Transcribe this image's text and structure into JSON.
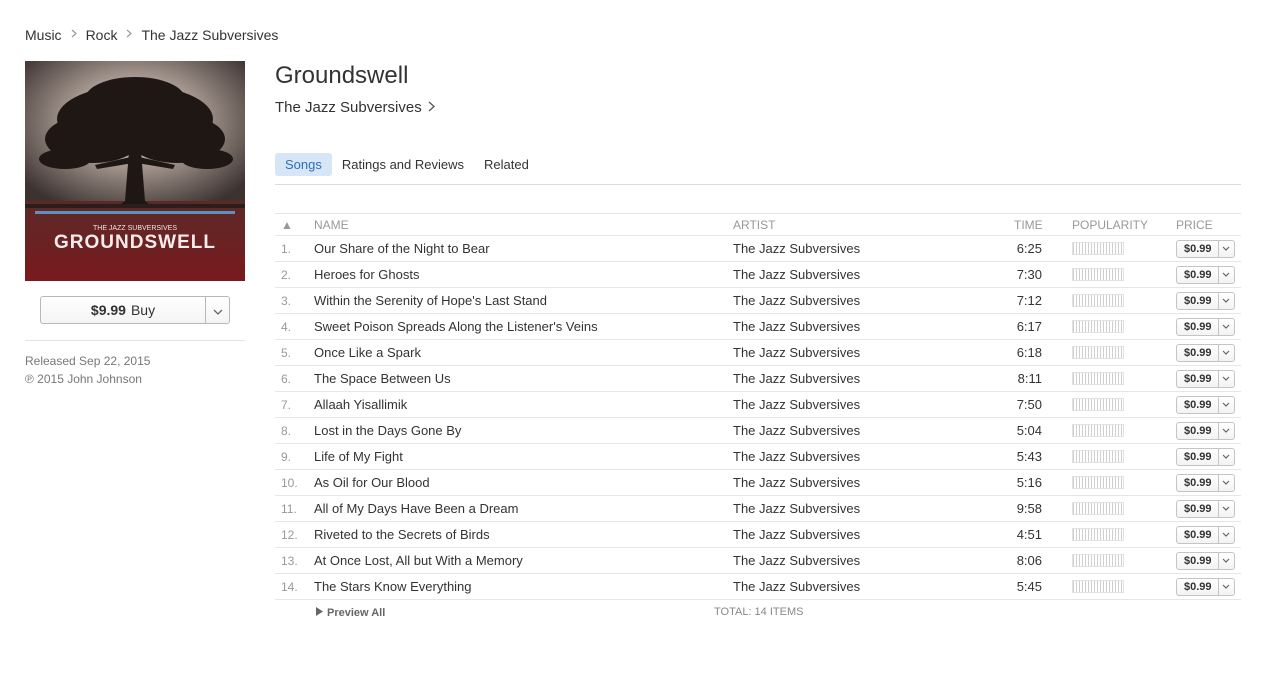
{
  "breadcrumb": [
    "Music",
    "Rock",
    "The Jazz Subversives"
  ],
  "album": {
    "title": "Groundswell",
    "artist": "The Jazz Subversives",
    "cover_band_text": "THE JAZZ SUBVERSIVES",
    "cover_title_text": "GROUNDSWELL",
    "price": "$9.99",
    "buy_label": "Buy",
    "released": "Released Sep 22, 2015",
    "copyright": "℗ 2015 John Johnson"
  },
  "tabs": [
    {
      "label": "Songs",
      "active": true
    },
    {
      "label": "Ratings and Reviews",
      "active": false
    },
    {
      "label": "Related",
      "active": false
    }
  ],
  "columns": {
    "sort_indicator": "▲",
    "name": "NAME",
    "artist": "ARTIST",
    "time": "TIME",
    "popularity": "POPULARITY",
    "price": "PRICE"
  },
  "tracks": [
    {
      "num": "1.",
      "name": "Our Share of the Night to Bear",
      "artist": "The Jazz Subversives",
      "time": "6:25",
      "price": "$0.99"
    },
    {
      "num": "2.",
      "name": "Heroes for Ghosts",
      "artist": "The Jazz Subversives",
      "time": "7:30",
      "price": "$0.99"
    },
    {
      "num": "3.",
      "name": "Within the Serenity of Hope's Last Stand",
      "artist": "The Jazz Subversives",
      "time": "7:12",
      "price": "$0.99"
    },
    {
      "num": "4.",
      "name": "Sweet Poison Spreads Along the Listener's Veins",
      "artist": "The Jazz Subversives",
      "time": "6:17",
      "price": "$0.99"
    },
    {
      "num": "5.",
      "name": "Once Like a Spark",
      "artist": "The Jazz Subversives",
      "time": "6:18",
      "price": "$0.99"
    },
    {
      "num": "6.",
      "name": "The Space Between Us",
      "artist": "The Jazz Subversives",
      "time": "8:11",
      "price": "$0.99"
    },
    {
      "num": "7.",
      "name": "Allaah Yisallimik",
      "artist": "The Jazz Subversives",
      "time": "7:50",
      "price": "$0.99"
    },
    {
      "num": "8.",
      "name": "Lost in the Days Gone By",
      "artist": "The Jazz Subversives",
      "time": "5:04",
      "price": "$0.99"
    },
    {
      "num": "9.",
      "name": "Life of My Fight",
      "artist": "The Jazz Subversives",
      "time": "5:43",
      "price": "$0.99"
    },
    {
      "num": "10.",
      "name": "As Oil for Our Blood",
      "artist": "The Jazz Subversives",
      "time": "5:16",
      "price": "$0.99"
    },
    {
      "num": "11.",
      "name": "All of My Days Have Been a Dream",
      "artist": "The Jazz Subversives",
      "time": "9:58",
      "price": "$0.99"
    },
    {
      "num": "12.",
      "name": "Riveted to the Secrets of Birds",
      "artist": "The Jazz Subversives",
      "time": "4:51",
      "price": "$0.99"
    },
    {
      "num": "13.",
      "name": "At Once Lost, All but With a Memory",
      "artist": "The Jazz Subversives",
      "time": "8:06",
      "price": "$0.99"
    },
    {
      "num": "14.",
      "name": "The Stars Know Everything",
      "artist": "The Jazz Subversives",
      "time": "5:45",
      "price": "$0.99"
    }
  ],
  "footer": {
    "preview_all": "Preview All",
    "total": "TOTAL: 14 ITEMS"
  },
  "colors": {
    "active_tab_bg": "#d6e6f7",
    "active_tab_text": "#2e6dbb",
    "cover_red": "#9e1c22"
  }
}
